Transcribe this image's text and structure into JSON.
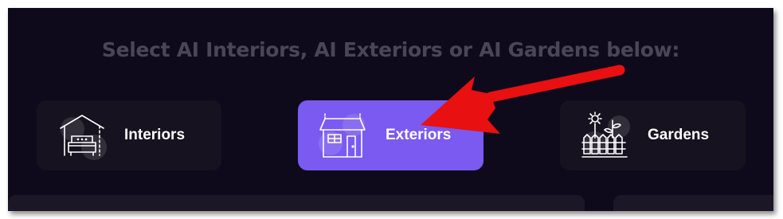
{
  "heading": "Select AI Interiors, AI Exteriors or AI Gardens below:",
  "cards": [
    {
      "label": "Interiors",
      "icon": "armchair-house-icon",
      "active": false
    },
    {
      "label": "Exteriors",
      "icon": "house-icon",
      "active": true
    },
    {
      "label": "Gardens",
      "icon": "flower-fence-icon",
      "active": false
    }
  ],
  "colors": {
    "background": "#0e0a1b",
    "card": "#16121f",
    "active_card": "#7a5af0",
    "heading": "#4a4558",
    "annotation_arrow": "#e81010"
  }
}
